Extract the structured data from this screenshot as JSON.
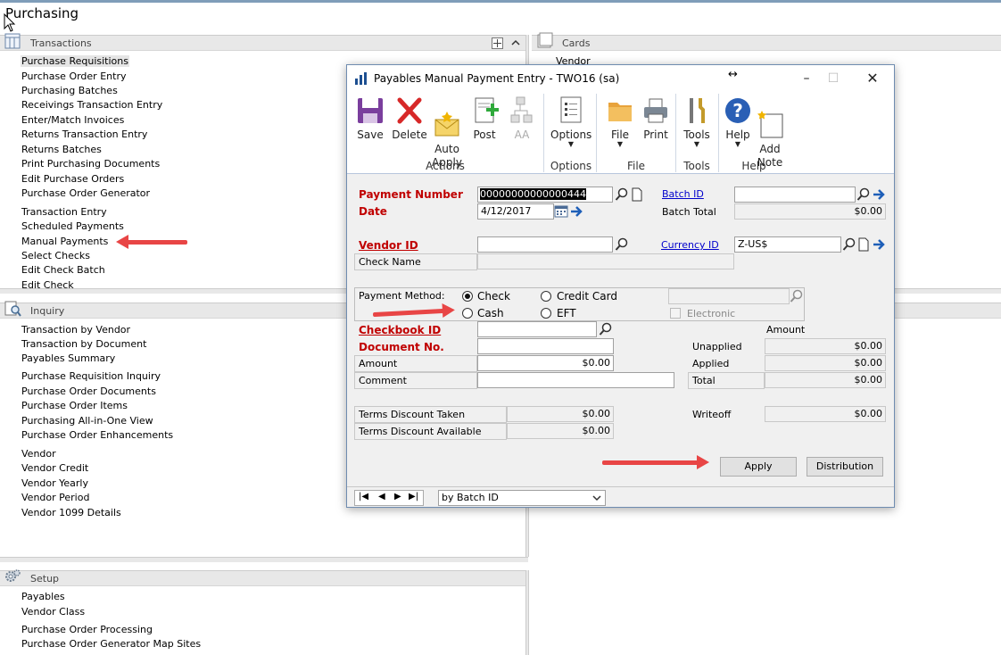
{
  "page": {
    "title": "Purchasing"
  },
  "transactions": {
    "header": "Transactions",
    "items": [
      "Purchase Requisitions",
      "Purchase Order Entry",
      "Purchasing Batches",
      "Receivings Transaction Entry",
      "Enter/Match Invoices",
      "Returns Transaction Entry",
      "Returns Batches",
      "Print Purchasing Documents",
      "Edit Purchase Orders",
      "Purchase Order Generator",
      "Transaction Entry",
      "Scheduled Payments",
      "Manual Payments",
      "Select Checks",
      "Edit Check Batch",
      "Edit Check"
    ]
  },
  "cards": {
    "header": "Cards",
    "items": [
      "Vendor"
    ]
  },
  "inquiry": {
    "header": "Inquiry",
    "items": [
      "Transaction by Vendor",
      "Transaction by Document",
      "Payables Summary",
      "Purchase Requisition Inquiry",
      "Purchase Order Documents",
      "Purchase Order Items",
      "Purchasing All-in-One View",
      "Purchase Order Enhancements",
      "Vendor",
      "Vendor Credit",
      "Vendor Yearly",
      "Vendor Period",
      "Vendor 1099 Details"
    ]
  },
  "setup": {
    "header": "Setup",
    "items": [
      "Payables",
      "Vendor Class",
      "Purchase Order Processing",
      "Purchase Order Generator Map Sites"
    ]
  },
  "dialog": {
    "title": "Payables Manual Payment Entry  -  TWO16 (sa)",
    "ribbon": {
      "save": "Save",
      "delete": "Delete",
      "auto_apply": "Auto\nApply",
      "post": "Post",
      "aa": "AA",
      "options": "Options",
      "file": "File",
      "print": "Print",
      "tools": "Tools",
      "help": "Help",
      "add_note": "Add\nNote",
      "group_actions": "Actions",
      "group_options": "Options",
      "group_file": "File",
      "group_tools": "Tools",
      "group_help": "Help"
    },
    "payment_number_label": "Payment Number",
    "payment_number": "00000000000000444",
    "date_label": "Date",
    "date": "4/12/2017",
    "batch_id_label": "Batch ID",
    "batch_id": "",
    "batch_total_label": "Batch Total",
    "batch_total": "$0.00",
    "vendor_id_label": "Vendor ID",
    "vendor_id": "",
    "currency_id_label": "Currency ID",
    "currency_id": "Z-US$",
    "check_name_label": "Check Name",
    "payment_method_label": "Payment Method:",
    "pm_check": "Check",
    "pm_cash": "Cash",
    "pm_credit_card": "Credit Card",
    "pm_eft": "EFT",
    "electronic_label": "Electronic",
    "checkbook_id_label": "Checkbook ID",
    "document_no_label": "Document No.",
    "amount_label": "Amount",
    "amount": "$0.00",
    "comment_label": "Comment",
    "amount_col_label": "Amount",
    "unapplied_label": "Unapplied",
    "unapplied": "$0.00",
    "applied_label": "Applied",
    "applied": "$0.00",
    "total_label": "Total",
    "total": "$0.00",
    "terms_discount_taken_label": "Terms Discount Taken",
    "terms_discount_taken": "$0.00",
    "terms_discount_available_label": "Terms Discount Available",
    "terms_discount_available": "$0.00",
    "writeoff_label": "Writeoff",
    "writeoff": "$0.00",
    "apply_button": "Apply",
    "distribution_button": "Distribution",
    "sort_by": "by Batch ID"
  },
  "colors": {
    "required": "#c00000",
    "link": "#0000cc",
    "annotation_arrow": "#e84545"
  }
}
